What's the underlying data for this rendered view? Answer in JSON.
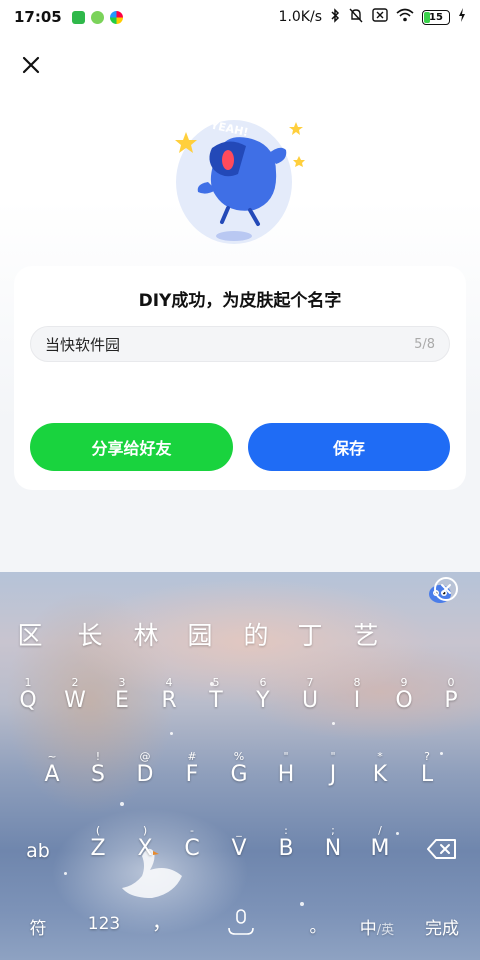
{
  "status_bar": {
    "time": "17:05",
    "net_speed": "1.0K/s",
    "battery": "15"
  },
  "dialog": {
    "title": "DIY成功，为皮肤起个名字",
    "name_value": "当快软件园",
    "name_counter": "5/8",
    "share_label": "分享给好友",
    "save_label": "保存",
    "mascot_text": "YEAH!"
  },
  "keyboard": {
    "candidates": [
      "区",
      "长",
      "林",
      "园",
      "的",
      "丁",
      "艺"
    ],
    "row1": [
      {
        "main": "Q",
        "sub": "1"
      },
      {
        "main": "W",
        "sub": "2"
      },
      {
        "main": "E",
        "sub": "3"
      },
      {
        "main": "R",
        "sub": "4"
      },
      {
        "main": "T",
        "sub": "5"
      },
      {
        "main": "Y",
        "sub": "6"
      },
      {
        "main": "U",
        "sub": "7"
      },
      {
        "main": "I",
        "sub": "8"
      },
      {
        "main": "O",
        "sub": "9"
      },
      {
        "main": "P",
        "sub": "0"
      }
    ],
    "row2": [
      {
        "main": "A",
        "sub": "~"
      },
      {
        "main": "S",
        "sub": "!"
      },
      {
        "main": "D",
        "sub": "@"
      },
      {
        "main": "F",
        "sub": "#"
      },
      {
        "main": "G",
        "sub": "%"
      },
      {
        "main": "H",
        "sub": "\""
      },
      {
        "main": "J",
        "sub": "\""
      },
      {
        "main": "K",
        "sub": "*"
      },
      {
        "main": "L",
        "sub": "?"
      }
    ],
    "row3": [
      {
        "main": "Z",
        "sub": "("
      },
      {
        "main": "X",
        "sub": ")"
      },
      {
        "main": "C",
        "sub": "-"
      },
      {
        "main": "V",
        "sub": "_"
      },
      {
        "main": "B",
        "sub": ":"
      },
      {
        "main": "N",
        "sub": ";"
      },
      {
        "main": "M",
        "sub": "/"
      }
    ],
    "ab_label": "ab",
    "symbol_label": "符",
    "num_label": "123",
    "comma_label": "，",
    "period_label": "。",
    "lang_main": "中",
    "lang_alt": "/英",
    "done_label": "完成"
  },
  "colors": {
    "share_green": "#19d33e",
    "save_blue": "#1f6cf5"
  }
}
